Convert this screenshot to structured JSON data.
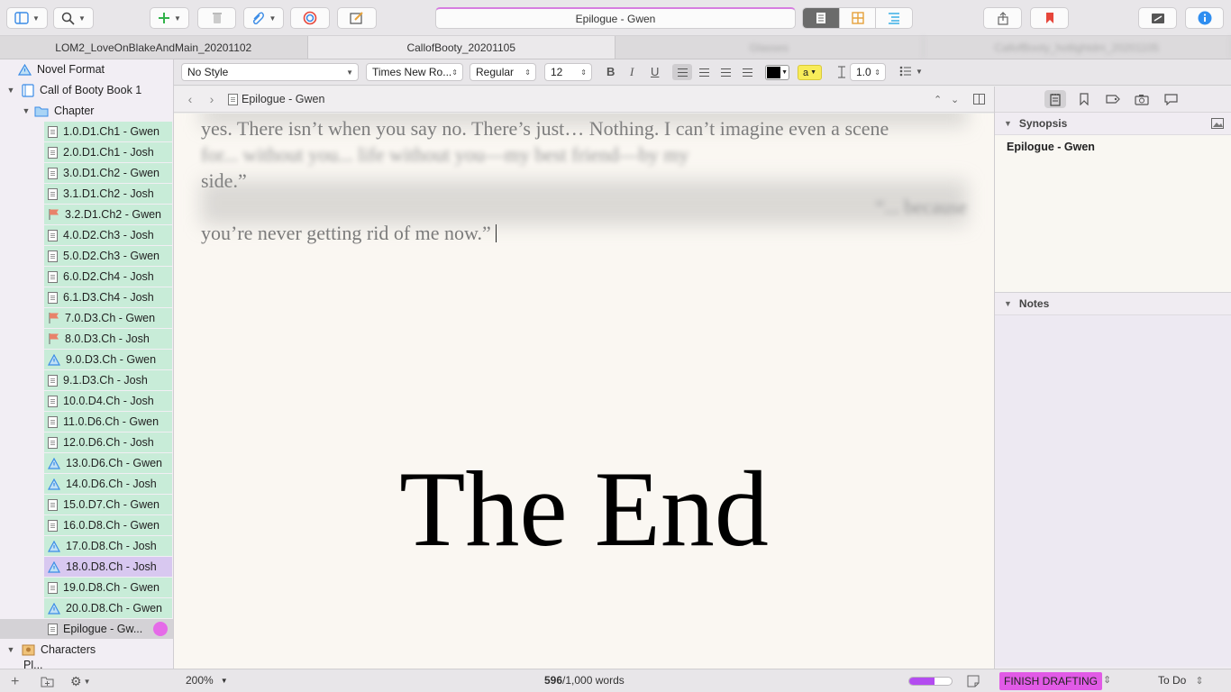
{
  "app": {
    "window_title": "Epilogue - Gwen"
  },
  "tabs": [
    {
      "label": "LOM2_LoveOnBlakeAndMain_20201102"
    },
    {
      "label": "CallofBooty_20201105"
    },
    {
      "label": "Glasses"
    },
    {
      "label": "CallofBooty_hotlightdm_20201105"
    }
  ],
  "binder": {
    "novel_format": "Novel Format",
    "book": "Call of Booty Book 1",
    "chapter_folder": "Chapter",
    "items": [
      {
        "label": "1.0.D1.Ch1 - Gwen",
        "icon": "doc"
      },
      {
        "label": "2.0.D1.Ch1 - Josh",
        "icon": "doc"
      },
      {
        "label": "3.0.D1.Ch2 - Gwen",
        "icon": "doc"
      },
      {
        "label": "3.1.D1.Ch2 - Josh",
        "icon": "doc"
      },
      {
        "label": "3.2.D1.Ch2 - Gwen",
        "icon": "flag"
      },
      {
        "label": "4.0.D2.Ch3 - Josh",
        "icon": "doc"
      },
      {
        "label": "5.0.D2.Ch3 - Gwen",
        "icon": "doc"
      },
      {
        "label": "6.0.D2.Ch4 - Josh",
        "icon": "doc"
      },
      {
        "label": "6.1.D3.Ch4 - Josh",
        "icon": "doc"
      },
      {
        "label": "7.0.D3.Ch - Gwen",
        "icon": "flag"
      },
      {
        "label": "8.0.D3.Ch - Josh",
        "icon": "flag"
      },
      {
        "label": "9.0.D3.Ch - Gwen",
        "icon": "warning"
      },
      {
        "label": "9.1.D3.Ch - Josh",
        "icon": "doc"
      },
      {
        "label": "10.0.D4.Ch - Josh",
        "icon": "doc"
      },
      {
        "label": "11.0.D6.Ch - Gwen",
        "icon": "doc"
      },
      {
        "label": "12.0.D6.Ch - Josh",
        "icon": "doc"
      },
      {
        "label": "13.0.D6.Ch - Gwen",
        "icon": "warning"
      },
      {
        "label": "14.0.D6.Ch - Josh",
        "icon": "warning"
      },
      {
        "label": "15.0.D7.Ch - Gwen",
        "icon": "doc"
      },
      {
        "label": "16.0.D8.Ch - Gwen",
        "icon": "doc"
      },
      {
        "label": "17.0.D8.Ch - Josh",
        "icon": "warning"
      },
      {
        "label": "18.0.D8.Ch - Josh",
        "icon": "warning"
      },
      {
        "label": "19.0.D8.Ch - Gwen",
        "icon": "doc"
      },
      {
        "label": "20.0.D8.Ch - Gwen",
        "icon": "warning"
      }
    ],
    "current_item": "Epilogue - Gw...",
    "characters": "Characters",
    "places": "Pl..."
  },
  "format_bar": {
    "style": "No Style",
    "font": "Times New Ro...",
    "weight": "Regular",
    "size": "12",
    "highlight_label": "a",
    "line_spacing": "1.0",
    "bold": "B",
    "italic": "I",
    "underline": "U"
  },
  "editor": {
    "header_title": "Epilogue - Gwen",
    "para1_line1": "yes. There isn’t when you say no. There’s just… Nothing. I can’t imagine even a scene",
    "para1_line2": "for... without you... life without you—my best friend—by my",
    "para1_line3": "side.”",
    "para2_line1": "“... because",
    "para2_line2": "you’re never getting rid of me now.”",
    "end_text": "The End"
  },
  "inspector": {
    "synopsis_label": "Synopsis",
    "synopsis_text": "Epilogue - Gwen",
    "notes_label": "Notes"
  },
  "footer": {
    "zoom": "200%",
    "word_count": "596",
    "word_target": "/1,000 words",
    "progress": 0.6,
    "status": "FINISH DRAFTING",
    "label": "To Do"
  },
  "colors": {
    "accent_pink": "#e15ae6",
    "binder_green": "#c8ecd8",
    "binder_selected": "#d8c8f0",
    "progress_purple": "#b34cf0"
  }
}
